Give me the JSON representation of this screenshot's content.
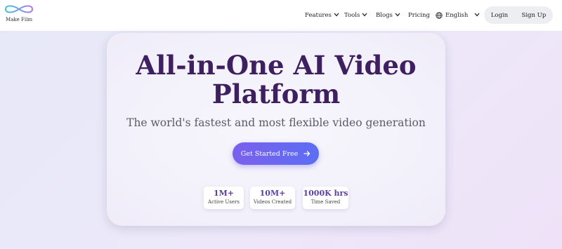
{
  "header": {
    "logo_text": "Make Film",
    "nav": [
      {
        "label": "Features",
        "dropdown": true
      },
      {
        "label": "Tools",
        "dropdown": true
      },
      {
        "label": "Blogs",
        "dropdown": true
      },
      {
        "label": "Pricing",
        "dropdown": false
      }
    ],
    "language": "English",
    "login_label": "Login",
    "signup_label": "Sign Up"
  },
  "hero": {
    "title_line1": "All-in-One AI Video",
    "title_line2": "Platform",
    "subtitle": "The world's fastest and most flexible video generation",
    "cta_label": "Get Started Free",
    "stats": [
      {
        "value": "1M+",
        "label": "Active Users"
      },
      {
        "value": "10M+",
        "label": "Videos Created"
      },
      {
        "value": "1000K hrs",
        "label": "Time Saved"
      }
    ]
  },
  "colors": {
    "title": "#3e1f5f",
    "accent_start": "#7a60ee",
    "accent_end": "#5c6ef2",
    "stat_value": "#5b3fa6"
  },
  "icons": [
    "infinity-logo-icon",
    "chevron-down-icon",
    "globe-icon",
    "arrow-right-icon"
  ]
}
